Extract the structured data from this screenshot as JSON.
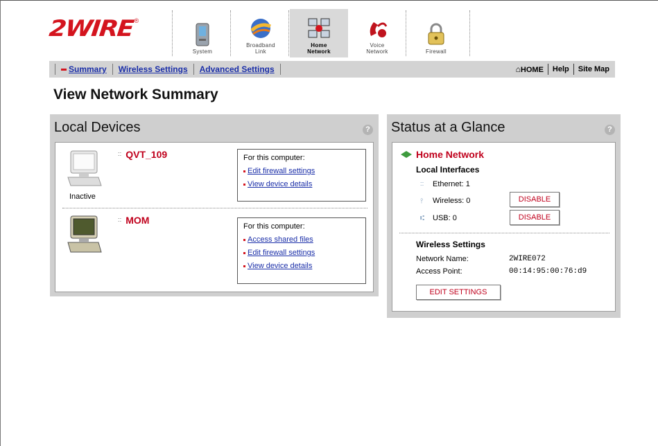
{
  "brand": {
    "logo_text": "2WIRE",
    "reg_mark": "®",
    "color": "#d4141e"
  },
  "nav_tabs": [
    {
      "label": "System",
      "icon": "system-icon",
      "active": false
    },
    {
      "label": "Broadband\nLink",
      "icon": "broadband-link-icon",
      "active": false
    },
    {
      "label": "Home\nNetwork",
      "icon": "home-network-icon",
      "active": true
    },
    {
      "label": "Voice\nNetwork",
      "icon": "voice-network-icon",
      "active": false
    },
    {
      "label": "Firewall",
      "icon": "firewall-icon",
      "active": false
    }
  ],
  "subnav": {
    "items": [
      {
        "label": "Summary",
        "active": true
      },
      {
        "label": "Wireless Settings",
        "active": false
      },
      {
        "label": "Advanced Settings",
        "active": false
      }
    ],
    "home": "HOME",
    "help": "Help",
    "site_map": "Site Map"
  },
  "page_title": "View Network Summary",
  "local_devices": {
    "title": "Local Devices",
    "help": "?",
    "devices": [
      {
        "name": "QVT_109",
        "status": "Inactive",
        "actions_header": "For this computer:",
        "actions": [
          "Edit firewall settings",
          "View device details"
        ]
      },
      {
        "name": "MOM",
        "status": "",
        "actions_header": "For this computer:",
        "actions": [
          "Access shared files",
          "Edit firewall settings",
          "View device details"
        ]
      }
    ]
  },
  "status": {
    "title": "Status at a Glance",
    "help": "?",
    "home_network": "Home Network",
    "local_interfaces_title": "Local Interfaces",
    "interfaces": [
      {
        "label": "Ethernet:",
        "value": "1",
        "icon": "ethernet-icon",
        "button": null
      },
      {
        "label": "Wireless:",
        "value": "0",
        "icon": "wireless-icon",
        "button": "DISABLE"
      },
      {
        "label": "USB:",
        "value": "0",
        "icon": "usb-icon",
        "button": "DISABLE"
      }
    ],
    "wireless_title": "Wireless Settings",
    "network_name_label": "Network Name:",
    "network_name": "2WIRE072",
    "access_point_label": "Access Point:",
    "access_point": "00:14:95:00:76:d9",
    "edit_button": "EDIT SETTINGS"
  }
}
